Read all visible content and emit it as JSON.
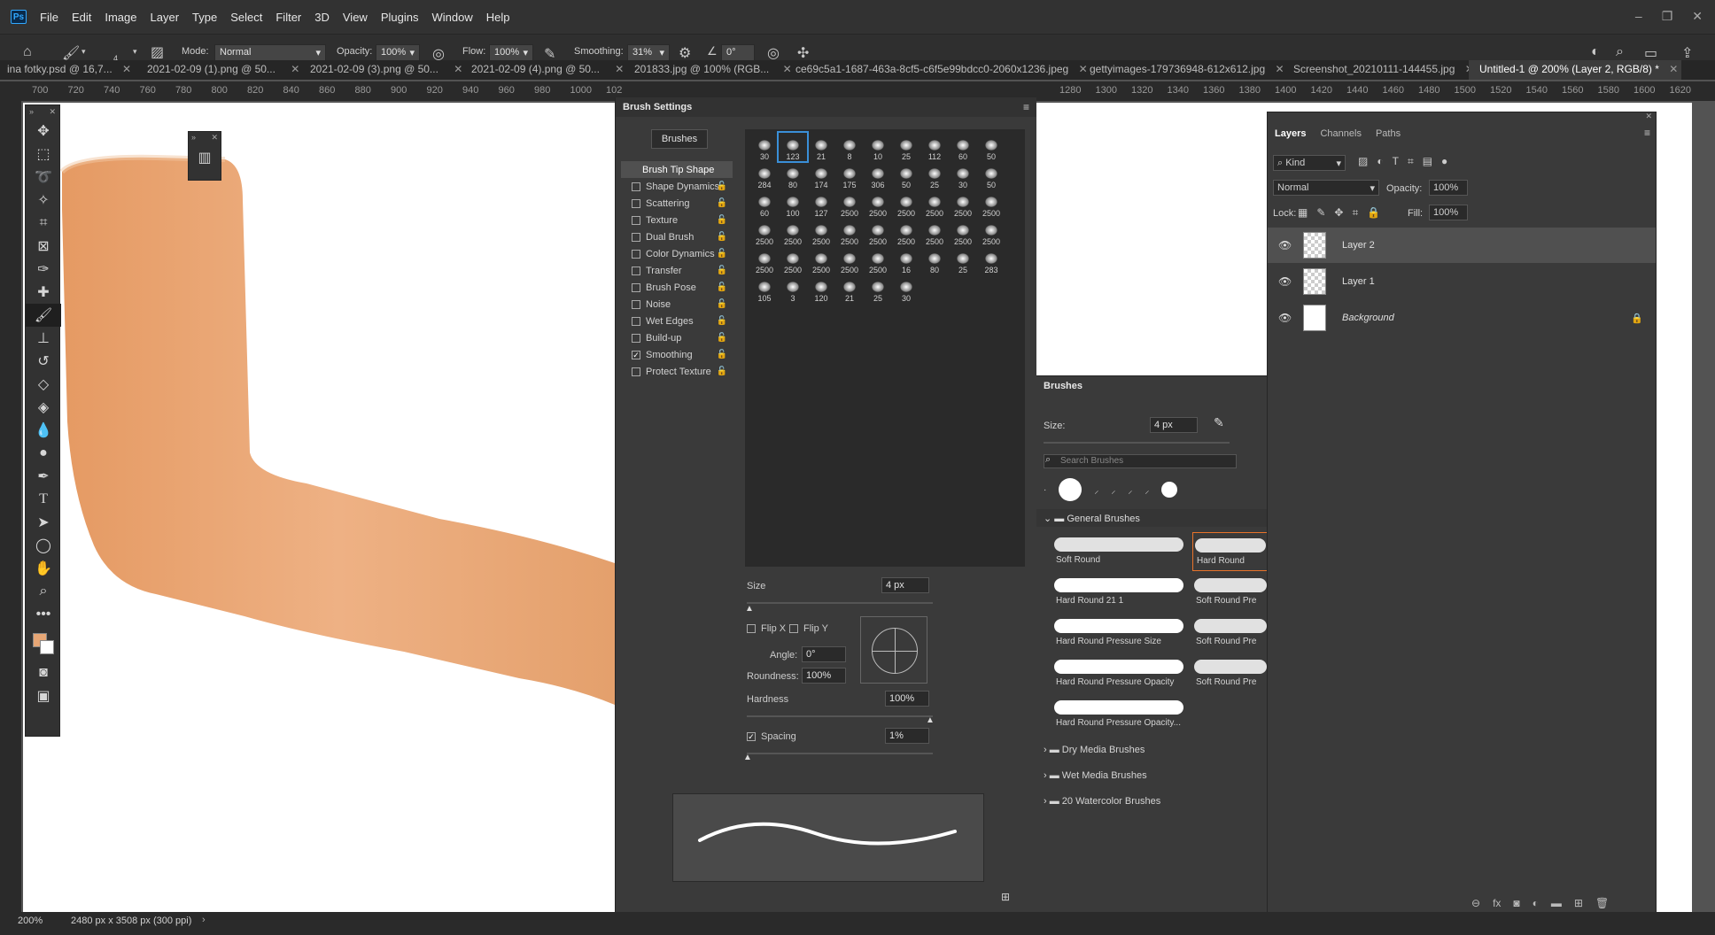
{
  "app": {
    "logo": "Ps"
  },
  "menu": [
    "File",
    "Edit",
    "Image",
    "Layer",
    "Type",
    "Select",
    "Filter",
    "3D",
    "View",
    "Plugins",
    "Window",
    "Help"
  ],
  "options": {
    "brush_size": "4",
    "mode_label": "Mode:",
    "mode_value": "Normal",
    "opacity_label": "Opacity:",
    "opacity_value": "100%",
    "flow_label": "Flow:",
    "flow_value": "100%",
    "smoothing_label": "Smoothing:",
    "smoothing_value": "31%",
    "angle_value": "0°"
  },
  "tabs": [
    {
      "label": "ina fotky.psd @ 16,7..."
    },
    {
      "label": "2021-02-09 (1).png @ 50..."
    },
    {
      "label": "2021-02-09 (3).png @ 50..."
    },
    {
      "label": "2021-02-09 (4).png @ 50..."
    },
    {
      "label": "201833.jpg @ 100% (RGB..."
    },
    {
      "label": "ce69c5a1-1687-463a-8cf5-c6f5e99bdcc0-2060x1236.jpeg"
    },
    {
      "label": "gettyimages-179736948-612x612.jpg"
    },
    {
      "label": "Screenshot_20210111-144455.jpg"
    },
    {
      "label": "Untitled-1 @ 200% (Layer 2, RGB/8) *"
    }
  ],
  "ruler_left": [
    "700",
    "720",
    "740",
    "760",
    "780",
    "800",
    "820",
    "840",
    "860",
    "880",
    "900",
    "920",
    "940",
    "960",
    "980",
    "1000",
    "102"
  ],
  "ruler_right": [
    "1280",
    "1300",
    "1320",
    "1340",
    "1360",
    "1380",
    "1400",
    "1420",
    "1440",
    "1460",
    "1480",
    "1500",
    "1520",
    "1540",
    "1560",
    "1580",
    "1600",
    "1620"
  ],
  "brush_settings": {
    "title": "Brush Settings",
    "brushes_button": "Brushes",
    "items": [
      {
        "label": "Brush Tip Shape",
        "checkbox": false,
        "checked": false,
        "active": true
      },
      {
        "label": "Shape Dynamics",
        "checkbox": true,
        "checked": false
      },
      {
        "label": "Scattering",
        "checkbox": true,
        "checked": false
      },
      {
        "label": "Texture",
        "checkbox": true,
        "checked": false
      },
      {
        "label": "Dual Brush",
        "checkbox": true,
        "checked": false
      },
      {
        "label": "Color Dynamics",
        "checkbox": true,
        "checked": false
      },
      {
        "label": "Transfer",
        "checkbox": true,
        "checked": false
      },
      {
        "label": "Brush Pose",
        "checkbox": true,
        "checked": false
      },
      {
        "label": "Noise",
        "checkbox": true,
        "checked": false
      },
      {
        "label": "Wet Edges",
        "checkbox": true,
        "checked": false
      },
      {
        "label": "Build-up",
        "checkbox": true,
        "checked": false
      },
      {
        "label": "Smoothing",
        "checkbox": true,
        "checked": true
      },
      {
        "label": "Protect Texture",
        "checkbox": true,
        "checked": false
      }
    ],
    "tip_sizes": [
      "30",
      "123",
      "21",
      "8",
      "10",
      "25",
      "112",
      "60",
      "50",
      "284",
      "80",
      "174",
      "175",
      "306",
      "50",
      "25",
      "30",
      "50",
      "60",
      "100",
      "127",
      "2500",
      "2500",
      "2500",
      "2500",
      "2500",
      "2500",
      "2500",
      "2500",
      "2500",
      "2500",
      "2500",
      "2500",
      "2500",
      "2500",
      "2500",
      "2500",
      "2500",
      "2500",
      "2500",
      "2500",
      "16",
      "80",
      "25",
      "283",
      "105",
      "3",
      "120",
      "21",
      "25",
      "30"
    ],
    "size_label": "Size",
    "size_value": "4 px",
    "flip_x": "Flip X",
    "flip_y": "Flip Y",
    "angle_label": "Angle:",
    "angle_value": "0°",
    "roundness_label": "Roundness:",
    "roundness_value": "100%",
    "hardness_label": "Hardness",
    "hardness_value": "100%",
    "spacing_label": "Spacing",
    "spacing_value": "1%"
  },
  "brushes_panel": {
    "title": "Brushes",
    "size_label": "Size:",
    "size_value": "4 px",
    "search_placeholder": "Search Brushes",
    "group_general": "General Brushes",
    "presets": [
      {
        "label": "Soft Round"
      },
      {
        "label": "Hard Round"
      },
      {
        "label": "Hard Round 21 1"
      },
      {
        "label": "Soft Round Pre"
      },
      {
        "label": "Hard Round Pressure Size"
      },
      {
        "label": "Soft Round Pre"
      },
      {
        "label": "Hard Round Pressure Opacity"
      },
      {
        "label": "Soft Round Pre"
      },
      {
        "label": "Hard Round Pressure Opacity..."
      }
    ],
    "groups": [
      "Dry Media Brushes",
      "Wet Media Brushes",
      "20 Watercolor  Brushes"
    ]
  },
  "layers_panel": {
    "tabs": [
      "Layers",
      "Channels",
      "Paths"
    ],
    "kind_label": "Kind",
    "blend_mode": "Normal",
    "opacity_label": "Opacity:",
    "opacity_value": "100%",
    "lock_label": "Lock:",
    "fill_label": "Fill:",
    "fill_value": "100%",
    "layers": [
      {
        "name": "Layer 2",
        "selected": true,
        "type": "transparent"
      },
      {
        "name": "Layer 1",
        "selected": false,
        "type": "transparent"
      },
      {
        "name": "Background",
        "selected": false,
        "type": "white",
        "locked": true
      }
    ]
  },
  "status": {
    "zoom": "200%",
    "doc_info": "2480 px x 3508 px (300 ppi)"
  },
  "colors": {
    "foreground": "#e7a675",
    "background": "#ffffff",
    "arm": "#e9a673"
  }
}
